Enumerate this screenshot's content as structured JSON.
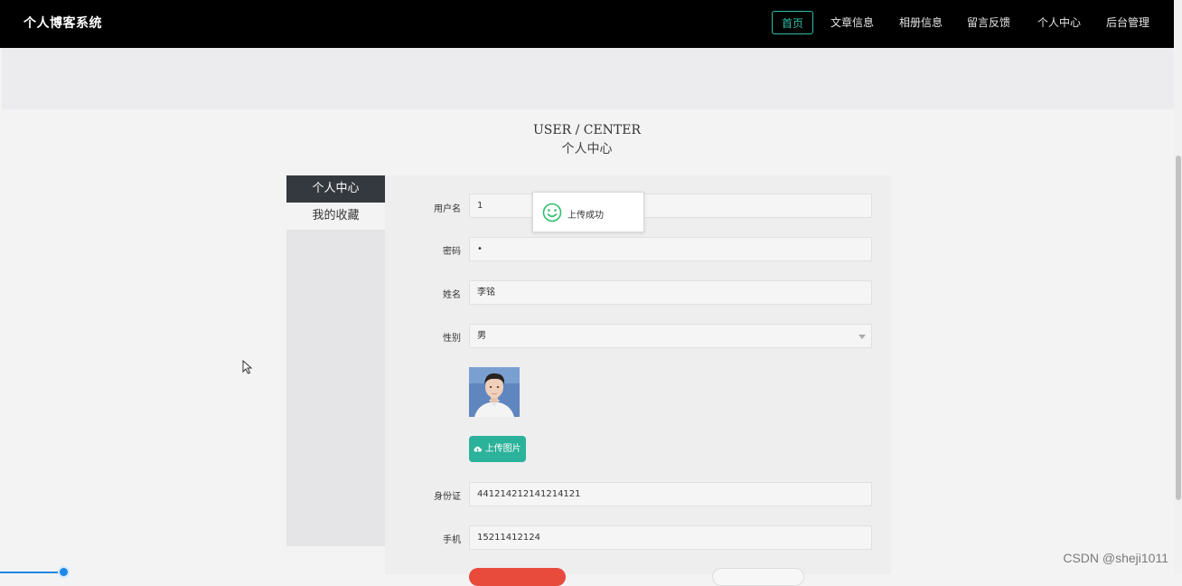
{
  "header": {
    "brand": "个人博客系统",
    "nav": [
      "首页",
      "文章信息",
      "相册信息",
      "留言反馈",
      "个人中心",
      "后台管理"
    ]
  },
  "page": {
    "title_en": "USER / CENTER",
    "title_zh": "个人中心"
  },
  "sidebar": {
    "items": [
      "个人中心",
      "我的收藏"
    ]
  },
  "form": {
    "username_label": "用户名",
    "username_value": "1",
    "password_label": "密码",
    "password_value": "•",
    "name_label": "姓名",
    "name_value": "李铭",
    "gender_label": "性别",
    "gender_value": "男",
    "upload_label": "上传图片",
    "idcard_label": "身份证",
    "idcard_value": "441214212141214121",
    "phone_label": "手机",
    "phone_value": "15211412124"
  },
  "toast": {
    "text": "上传成功",
    "icon": "smile-icon"
  },
  "watermark": "CSDN @sheji1011",
  "colors": {
    "accent": "#2bb29a",
    "header_bg": "#000000",
    "sidebar_active": "#34393f",
    "danger": "#e84a3c"
  }
}
